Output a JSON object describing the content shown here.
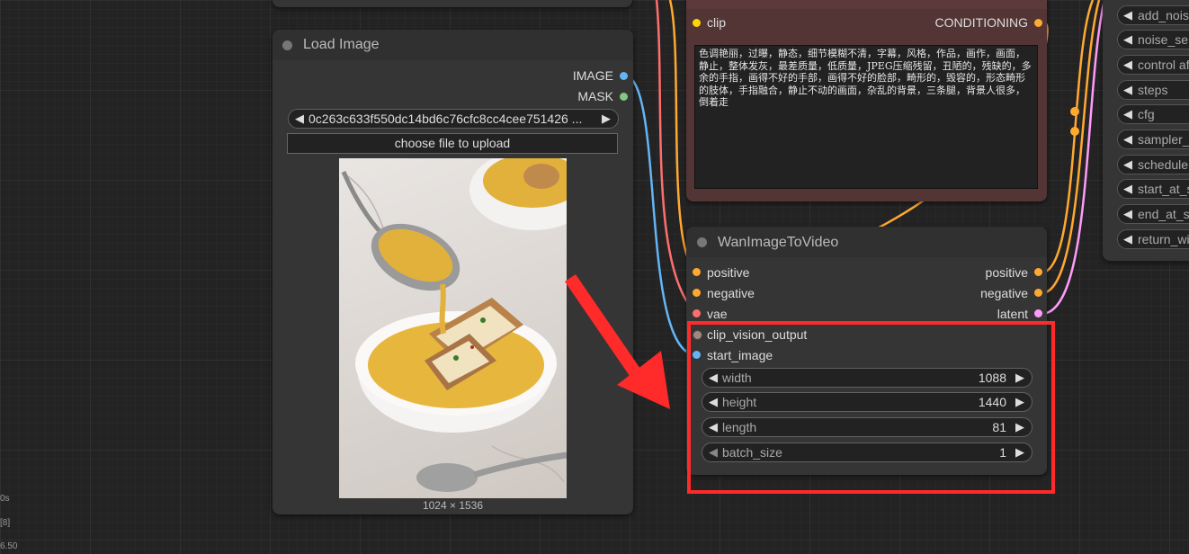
{
  "load_image": {
    "title": "Load Image",
    "outputs": [
      {
        "label": "IMAGE",
        "color": "#64B5F6"
      },
      {
        "label": "MASK",
        "color": "#81C784"
      }
    ],
    "image_filename": "0c263c633f550dc14bd6c76cfc8cc4cee751426 ...",
    "upload_label": "choose file to upload",
    "image_size": "1024 × 1536"
  },
  "text_encode": {
    "input_clip": "clip",
    "output_conditioning": "CONDITIONING",
    "prompt_text": "色调艳丽，过曝，静态，细节模糊不清，字幕，风格，作品，画作，画面，静止，整体发灰，最差质量，低质量，JPEG压缩残留，丑陋的，残缺的，多余的手指，画得不好的手部，画得不好的脸部，畸形的，毁容的，形态畸形的肢体，手指融合，静止不动的画面，杂乱的背景，三条腿，背景人很多，倒着走"
  },
  "wan_node": {
    "title": "WanImageToVideo",
    "inputs": [
      {
        "label": "positive",
        "color": "#FFA931"
      },
      {
        "label": "negative",
        "color": "#FFA931"
      },
      {
        "label": "vae",
        "color": "#FF6E6E"
      },
      {
        "label": "clip_vision_output",
        "color": "#A1887F"
      },
      {
        "label": "start_image",
        "color": "#64B5F6"
      }
    ],
    "outputs": [
      {
        "label": "positive",
        "color": "#FFA931"
      },
      {
        "label": "negative",
        "color": "#FFA931"
      },
      {
        "label": "latent",
        "color": "#FF9CF9"
      }
    ],
    "widgets": [
      {
        "label": "width",
        "value": "1088"
      },
      {
        "label": "height",
        "value": "1440"
      },
      {
        "label": "length",
        "value": "81"
      },
      {
        "label": "batch_size",
        "value": "1"
      }
    ]
  },
  "sampler_widgets": [
    "add_nois",
    "noise_se",
    "control af",
    "steps",
    "cfg",
    "sampler_",
    "schedule",
    "start_at_s",
    "end_at_s",
    "return_wi"
  ],
  "stats": [
    "0s",
    "[8]",
    "6.50"
  ],
  "colors": {
    "highlight": "#FF2A2A",
    "text_node_bg": "#533535"
  }
}
